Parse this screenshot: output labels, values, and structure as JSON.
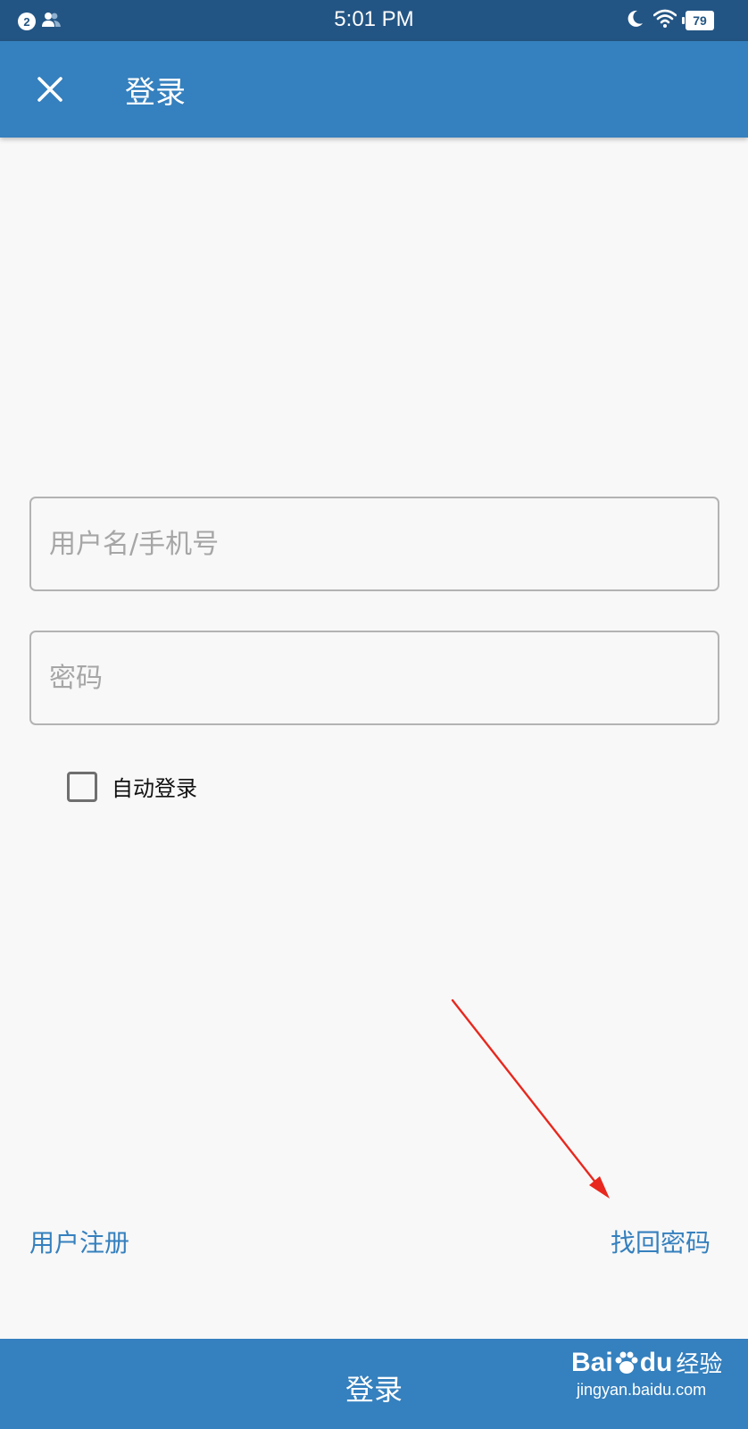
{
  "status_bar": {
    "notification_count": "2",
    "time": "5:01 PM",
    "battery": "79",
    "icons": [
      "notification-count-icon",
      "contacts-icon",
      "moon-icon",
      "wifi-icon",
      "battery-icon"
    ]
  },
  "app_bar": {
    "title": "登录",
    "close_icon": "close-icon",
    "background": "#3580be"
  },
  "form": {
    "username_placeholder": "用户名/手机号",
    "username_value": "",
    "password_placeholder": "密码",
    "password_value": "",
    "auto_login_label": "自动登录",
    "auto_login_checked": false
  },
  "links": {
    "register": "用户注册",
    "forgot_password": "找回密码"
  },
  "bottom": {
    "login_button_label": "登录"
  },
  "watermark": {
    "logo": "Bai",
    "logo_tail": "du",
    "subtitle": "经验",
    "url": "jingyan.baidu.com"
  },
  "colors": {
    "status_bar": "#235584",
    "accent": "#3580be",
    "background": "#f8f8f8",
    "annotation_arrow": "#e8281e"
  }
}
